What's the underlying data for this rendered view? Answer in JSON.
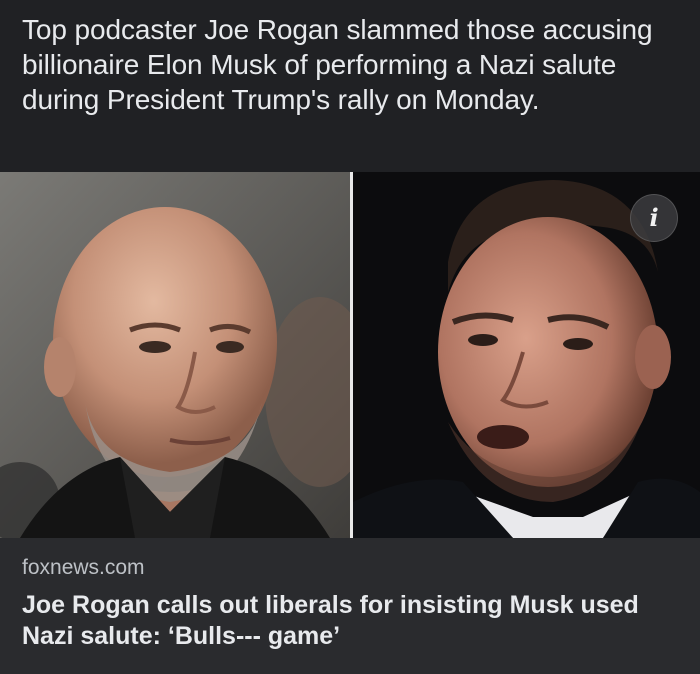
{
  "post": {
    "caption": "Top podcaster Joe Rogan slammed those accusing billionaire Elon Musk of performing a Nazi salute during President Trump's rally on Monday."
  },
  "card": {
    "source": "foxnews.com",
    "headline": "Joe Rogan calls out liberals for insisting Musk used Nazi salute: ‘Bulls--- game’",
    "info_glyph": "i",
    "info_icon": "info-icon"
  },
  "colors": {
    "background": "#202124",
    "card_background": "#2a2b2e",
    "text_primary": "#e8eaed",
    "text_secondary": "#bdc1c6"
  }
}
